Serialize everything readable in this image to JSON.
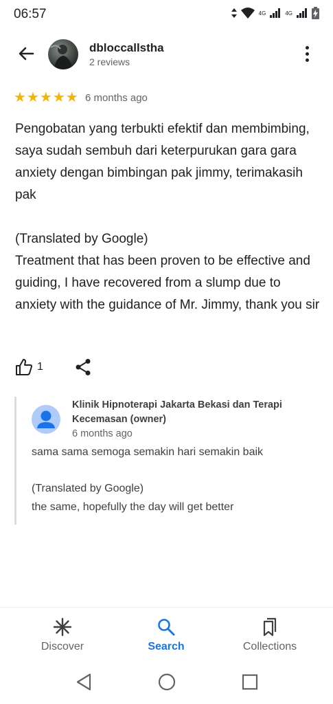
{
  "status_bar": {
    "time": "06:57",
    "network_1": "4G",
    "network_2": "4G"
  },
  "review": {
    "author": "dbloccallstha",
    "author_reviews": "2 reviews",
    "rating": 5,
    "rating_max": 5,
    "time_ago": "6 months ago",
    "text": "Pengobatan yang terbukti efektif dan membimbing, saya sudah sembuh dari keterpurukan gara gara anxiety dengan bimbingan pak jimmy, terimakasih pak\n\n(Translated by Google)\nTreatment that has been proven to be effective and guiding, I have recovered from a slump due to anxiety with the guidance of Mr. Jimmy, thank you sir",
    "like_count": "1"
  },
  "owner_reply": {
    "name": "Klinik Hipnoterapi Jakarta Bekasi dan Terapi Kecemasan (owner)",
    "time_ago": "6 months ago",
    "text": "sama sama semoga semakin hari semakin baik\n\n(Translated by Google)\nthe same, hopefully the day will get better"
  },
  "bottom_nav": {
    "items": [
      {
        "label": "Discover",
        "icon": "asterisk-icon",
        "active": false
      },
      {
        "label": "Search",
        "icon": "search-icon",
        "active": true
      },
      {
        "label": "Collections",
        "icon": "bookmarks-icon",
        "active": false
      }
    ]
  },
  "colors": {
    "accent": "#1a73e8",
    "star": "#f4b400",
    "text": "#202124",
    "muted": "#5f6368"
  }
}
